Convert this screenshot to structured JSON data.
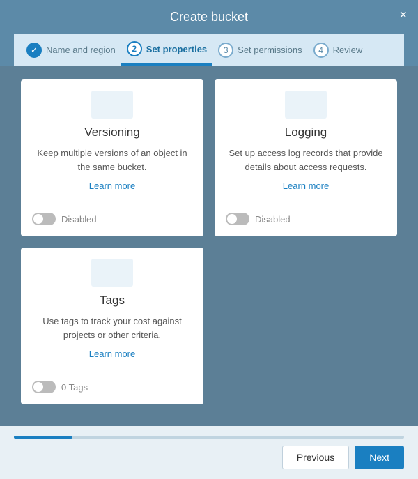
{
  "modal": {
    "title": "Create bucket",
    "close_label": "×"
  },
  "steps": [
    {
      "id": "step-1",
      "number": "✓",
      "label": "Name and region",
      "state": "done"
    },
    {
      "id": "step-2",
      "number": "2",
      "label": "Set properties",
      "state": "active"
    },
    {
      "id": "step-3",
      "number": "3",
      "label": "Set permissions",
      "state": "default"
    },
    {
      "id": "step-4",
      "number": "4",
      "label": "Review",
      "state": "default"
    }
  ],
  "cards": [
    {
      "id": "versioning",
      "title": "Versioning",
      "description": "Keep multiple versions of an object in the same bucket.",
      "learn_more": "Learn more",
      "toggle_state": "disabled",
      "toggle_label": "Disabled"
    },
    {
      "id": "logging",
      "title": "Logging",
      "description": "Set up access log records that provide details about access requests.",
      "learn_more": "Learn more",
      "toggle_state": "disabled",
      "toggle_label": "Disabled"
    },
    {
      "id": "tags",
      "title": "Tags",
      "description": "Use tags to track your cost against projects or other criteria.",
      "learn_more": "Learn more",
      "toggle_state": "disabled",
      "toggle_label": "0 Tags"
    }
  ],
  "footer": {
    "previous_label": "Previous",
    "next_label": "Next",
    "progress": 15
  }
}
